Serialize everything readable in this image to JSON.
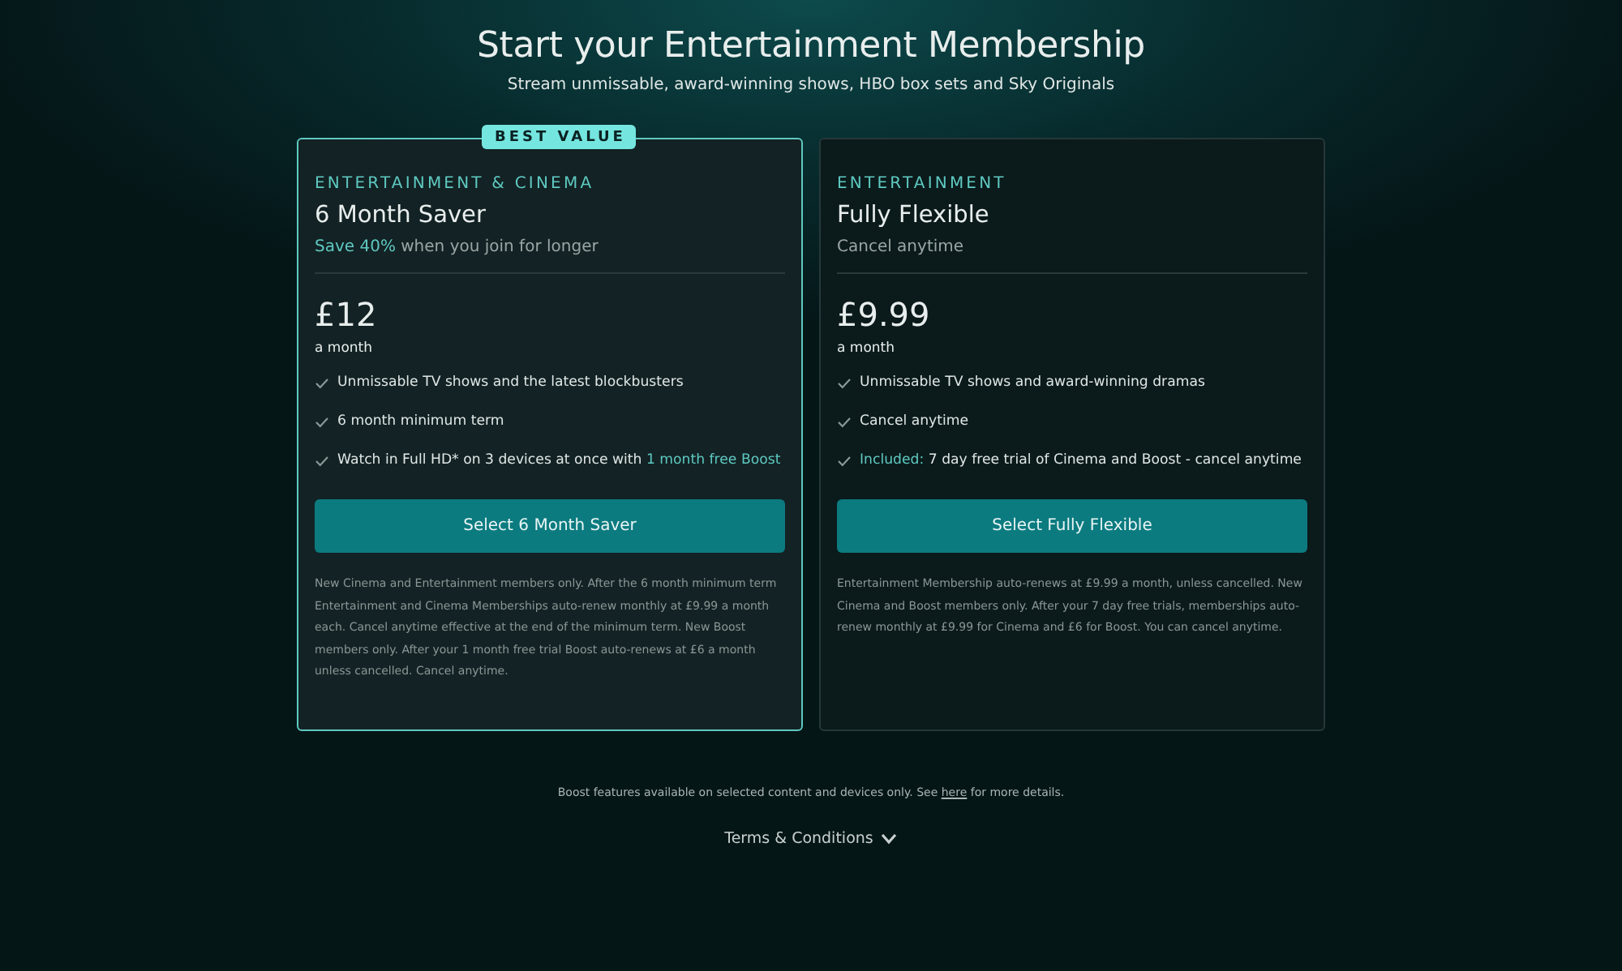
{
  "title": "Start your Entertainment Membership",
  "subtitle": "Stream unmissable, award-winning shows, HBO box sets and Sky Originals",
  "plans": [
    {
      "featured": true,
      "badge": "BEST VALUE",
      "category": "ENTERTAINMENT & CINEMA",
      "name": "6 Month Saver",
      "tagline": [
        {
          "text": "Save 40%",
          "accent": true
        },
        {
          "text": " when you join for longer",
          "accent": false
        }
      ],
      "price": "£12",
      "period": "a month",
      "features": [
        [
          {
            "text": "Unmissable TV shows and the latest blockbusters",
            "accent": false
          }
        ],
        [
          {
            "text": "6 month minimum term",
            "accent": false
          }
        ],
        [
          {
            "text": "Watch in Full HD* on 3 devices at once with ",
            "accent": false
          },
          {
            "text": "1 month free Boost",
            "accent": true
          }
        ]
      ],
      "button": "Select 6 Month Saver",
      "terms": "New Cinema and Entertainment members only. After the 6 month minimum term Entertainment and Cinema Memberships auto-renew monthly at £9.99 a month each. Cancel anytime effective at the end of the minimum term. New Boost members only. After your 1 month free trial Boost auto-renews at £6 a month unless cancelled. Cancel anytime."
    },
    {
      "featured": false,
      "category": "ENTERTAINMENT",
      "name": "Fully Flexible",
      "tagline": [
        {
          "text": "Cancel anytime",
          "accent": false
        }
      ],
      "price": "£9.99",
      "period": "a month",
      "features": [
        [
          {
            "text": "Unmissable TV shows and award-winning dramas",
            "accent": false
          }
        ],
        [
          {
            "text": "Cancel anytime",
            "accent": false
          }
        ],
        [
          {
            "text": "Included:",
            "accent": true
          },
          {
            "text": " 7 day free trial of Cinema and Boost - cancel anytime",
            "accent": false
          }
        ]
      ],
      "button": "Select Fully Flexible",
      "terms": "Entertainment Membership auto-renews at £9.99 a month, unless cancelled. New Cinema and Boost members only. After your 7 day free trials, memberships auto-renew monthly at £9.99 for Cinema and £6 for Boost. You can cancel anytime."
    }
  ],
  "footnote": {
    "before": "Boost features available on selected content and devices only. See ",
    "link": "here",
    "after": " for more details."
  },
  "terms_toggle": {
    "label": "Terms & Conditions",
    "expanded": false
  }
}
